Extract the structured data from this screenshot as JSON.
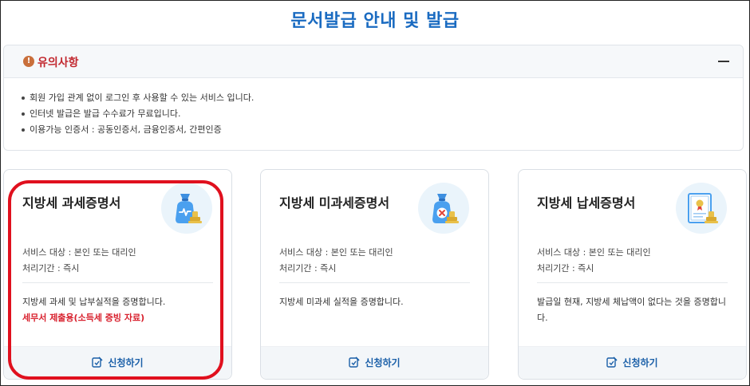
{
  "page": {
    "title": "문서발급 안내 및 발급"
  },
  "notice": {
    "icon": "exclamation-icon",
    "title": "유의사항",
    "items": [
      "회원 가입 관계 없이 로그인 후 사용할 수 있는 서비스 입니다.",
      "인터넷 발급은 발급 수수료가 무료입니다.",
      "이용가능 인증서 : 공동인증서, 금융인증서, 간편인증"
    ]
  },
  "cards": [
    {
      "title": "지방세 과세증명서",
      "icon": "tax-bag-stamp-icon",
      "target": "서비스 대상 : 본인 또는 대리인",
      "period": "처리기간 : 즉시",
      "description": "지방세 과세 및 납부실적을 증명합니다.",
      "note": "세무서 제출용(소득세 증빙 자료)",
      "apply_label": "신청하기"
    },
    {
      "title": "지방세 미과세증명서",
      "icon": "tax-bag-x-stamp-icon",
      "target": "서비스 대상 : 본인 또는 대리인",
      "period": "처리기간 : 즉시",
      "description": "지방세 미과세 실적을 증명합니다.",
      "note": "",
      "apply_label": "신청하기"
    },
    {
      "title": "지방세 납세증명서",
      "icon": "certificate-stamp-icon",
      "target": "서비스 대상 : 본인 또는 대리인",
      "period": "처리기간 : 즉시",
      "description": "발급일 현재, 지방세 체납액이 없다는 것을 증명합니다.",
      "note": "",
      "apply_label": "신청하기"
    }
  ],
  "colors": {
    "title": "#1a6bc1",
    "notice_title": "#c2282f",
    "note": "#d8202d",
    "apply": "#1a5fa8",
    "highlight": "#e0101e"
  }
}
